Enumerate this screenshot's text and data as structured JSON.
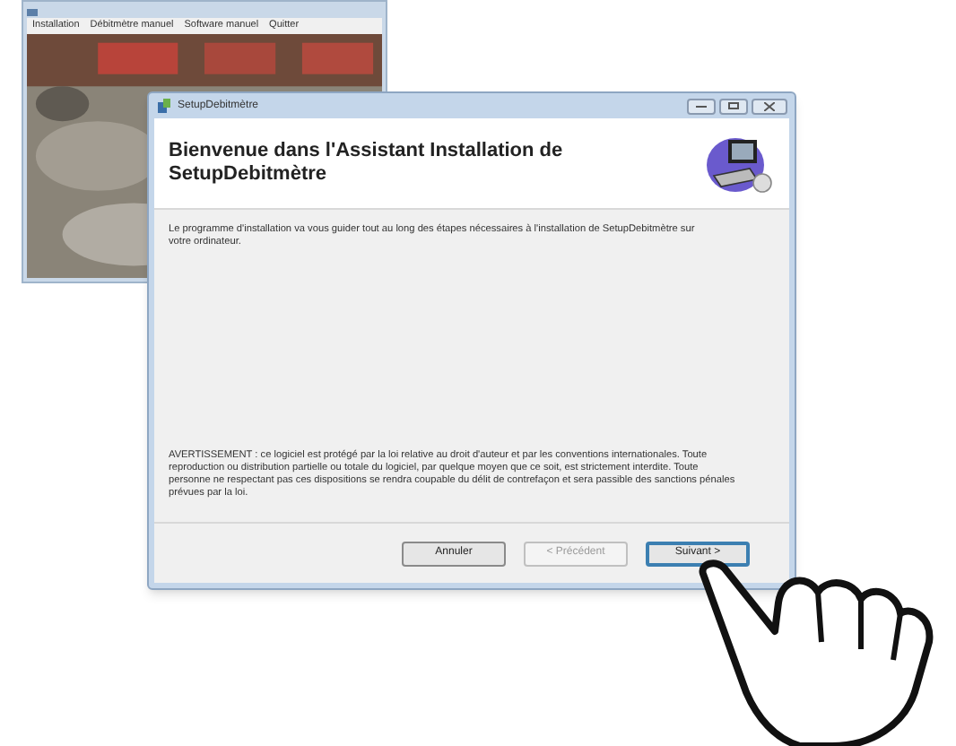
{
  "background_window": {
    "menu": [
      "Installation",
      "Débitmètre manuel",
      "Software manuel",
      "Quitter"
    ]
  },
  "window": {
    "title": "SetupDebitmètre"
  },
  "header": {
    "title": "Bienvenue dans l'Assistant Installation de SetupDebitmètre"
  },
  "intro": "Le programme d'installation va vous guider tout au long des étapes nécessaires à l'installation de SetupDebitmètre sur votre ordinateur.",
  "warning": "AVERTISSEMENT : ce logiciel est protégé par la loi relative au droit d'auteur et par les conventions internationales. Toute reproduction ou distribution partielle ou totale du logiciel, par quelque moyen que ce soit, est strictement interdite. Toute personne ne respectant pas ces dispositions se rendra coupable du délit de contrefaçon et sera passible des sanctions pénales prévues par la loi.",
  "buttons": [
    {
      "label": "Annuler",
      "disabled": false,
      "default": false
    },
    {
      "label": "< Précédent",
      "disabled": true,
      "default": false
    },
    {
      "label": "Suivant >",
      "disabled": false,
      "default": true
    }
  ]
}
